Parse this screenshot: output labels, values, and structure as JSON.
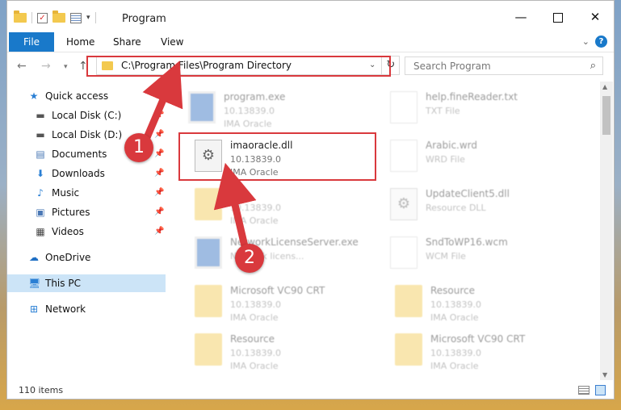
{
  "window": {
    "title": "Program",
    "controls": {
      "minimize": "—",
      "close": "✕"
    }
  },
  "ribbon": {
    "tabs": [
      "File",
      "Home",
      "Share",
      "View"
    ],
    "help": "?"
  },
  "navigation": {
    "address": "C:\\Program Files\\Program Directory",
    "search_placeholder": "Search Program"
  },
  "sidebar": {
    "items": [
      {
        "label": "Quick access",
        "icon": "star-icon",
        "pinned": false
      },
      {
        "label": "Local Disk (C:)",
        "icon": "drive-icon",
        "pinned": true
      },
      {
        "label": "Local Disk (D:)",
        "icon": "drive-icon",
        "pinned": true
      },
      {
        "label": "Documents",
        "icon": "documents-icon",
        "pinned": true
      },
      {
        "label": "Downloads",
        "icon": "download-icon",
        "pinned": true
      },
      {
        "label": "Music",
        "icon": "music-icon",
        "pinned": true
      },
      {
        "label": "Pictures",
        "icon": "pictures-icon",
        "pinned": true
      },
      {
        "label": "Videos",
        "icon": "videos-icon",
        "pinned": true
      },
      {
        "label": "OneDrive",
        "icon": "cloud-icon",
        "pinned": false
      },
      {
        "label": "This PC",
        "icon": "computer-icon",
        "pinned": false,
        "selected": true
      },
      {
        "label": "Network",
        "icon": "network-icon",
        "pinned": false
      }
    ]
  },
  "files": [
    {
      "name": "program.exe",
      "line2": "10.13839.0",
      "line3": "IMA Oracle",
      "icon": "app-icon"
    },
    {
      "name": "help.fineReader.txt",
      "line2": "TXT File",
      "line3": "",
      "icon": "document-icon"
    },
    {
      "name": "imaoracle.dll",
      "line2": "10.13839.0",
      "line3": "IMA Oracle",
      "icon": "dll-gear-icon",
      "highlighted": true
    },
    {
      "name": "Arabic.wrd",
      "line2": "WRD File",
      "line3": "",
      "icon": "document-icon"
    },
    {
      "name": "",
      "line2": "10.13839.0",
      "line3": "IMA Oracle",
      "icon": "folder-icon"
    },
    {
      "name": "UpdateClient5.dll",
      "line2": "Resource DLL",
      "line3": "",
      "icon": "dll-gear-icon"
    },
    {
      "name": "NetworkLicenseServer.exe",
      "line2": "Network licens...",
      "line3": "",
      "icon": "app-icon"
    },
    {
      "name": "SndToWP16.wcm",
      "line2": "WCM File",
      "line3": "",
      "icon": "document-icon"
    },
    {
      "name": "Microsoft VC90 CRT",
      "line2": "10.13839.0",
      "line3": "IMA Oracle",
      "icon": "folder-icon"
    },
    {
      "name": "Resource",
      "line2": "10.13839.0",
      "line3": "IMA Oracle",
      "icon": "folder-icon"
    },
    {
      "name": "Resource",
      "line2": "10.13839.0",
      "line3": "IMA Oracle",
      "icon": "folder-icon"
    },
    {
      "name": "Microsoft VC90 CRT",
      "line2": "10.13839.0",
      "line3": "IMA Oracle",
      "icon": "folder-icon"
    }
  ],
  "status": {
    "item_count": "110 items"
  },
  "annotations": {
    "step1": "1",
    "step2": "2"
  },
  "colors": {
    "accent": "#1979ca",
    "annotation": "#d9393d",
    "selection": "#cce4f7"
  }
}
